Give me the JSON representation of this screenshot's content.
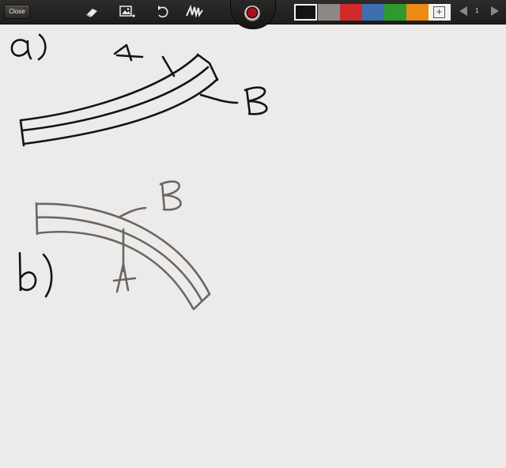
{
  "toolbar": {
    "close_label": "Close",
    "tools": [
      {
        "icon": "eraser-icon"
      },
      {
        "icon": "insert-image-icon"
      },
      {
        "icon": "undo-icon"
      },
      {
        "icon": "clear-scribble-icon"
      }
    ],
    "record_icon": "record-icon",
    "palette": {
      "selected": "#141414",
      "colors": [
        "#8c8886",
        "#d12a2a",
        "#3f6fb0",
        "#2e9a2e",
        "#ec8a13"
      ],
      "add_icon": "add-color-icon"
    },
    "page_number": "1"
  },
  "drawing": {
    "part_a": {
      "label": "a)",
      "callouts": [
        "A",
        "B"
      ],
      "stroke_color": "#141414"
    },
    "part_b": {
      "label": "b)",
      "callouts": [
        "B",
        "A"
      ],
      "stroke_color": "#6a6664"
    }
  }
}
